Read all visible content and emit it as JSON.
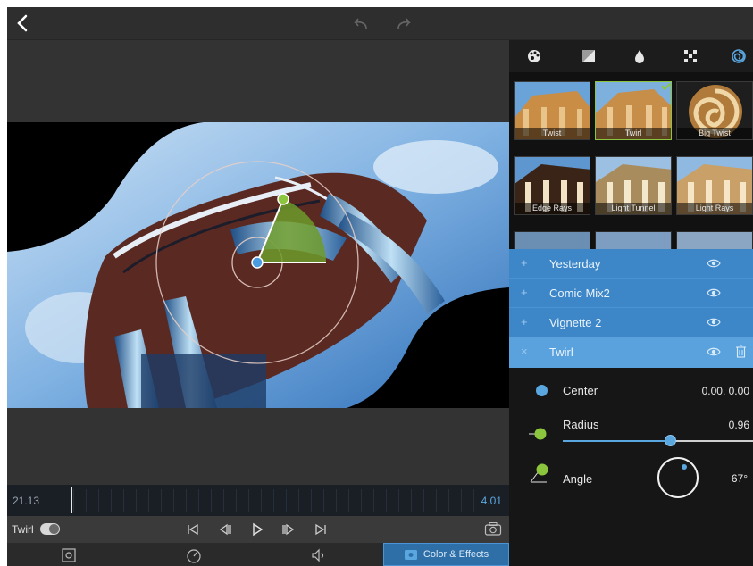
{
  "timeline": {
    "current_time": "21.13",
    "end_time": "4.01"
  },
  "transport": {
    "layer_name": "Twirl"
  },
  "bottombar": {
    "active_tab_label": "Color & Effects"
  },
  "presets": [
    {
      "label": "Twist"
    },
    {
      "label": "Twirl"
    },
    {
      "label": "Big Twist"
    },
    {
      "label": "Edge Rays"
    },
    {
      "label": "Light Tunnel"
    },
    {
      "label": "Light Rays"
    }
  ],
  "layers": [
    {
      "sign": "+",
      "name": "Yesterday"
    },
    {
      "sign": "+",
      "name": "Comic Mix2"
    },
    {
      "sign": "+",
      "name": "Vignette 2"
    },
    {
      "sign": "×",
      "name": "Twirl"
    }
  ],
  "params": {
    "center": {
      "label": "Center",
      "value": "0.00, 0.00"
    },
    "radius": {
      "label": "Radius",
      "value": "0.96",
      "level": 0.54
    },
    "angle": {
      "label": "Angle",
      "value": "67°"
    }
  },
  "colors": {
    "accent": "#5aa7e0",
    "panel_selection": "#3d86c8",
    "green_handle": "#8cc63f"
  }
}
